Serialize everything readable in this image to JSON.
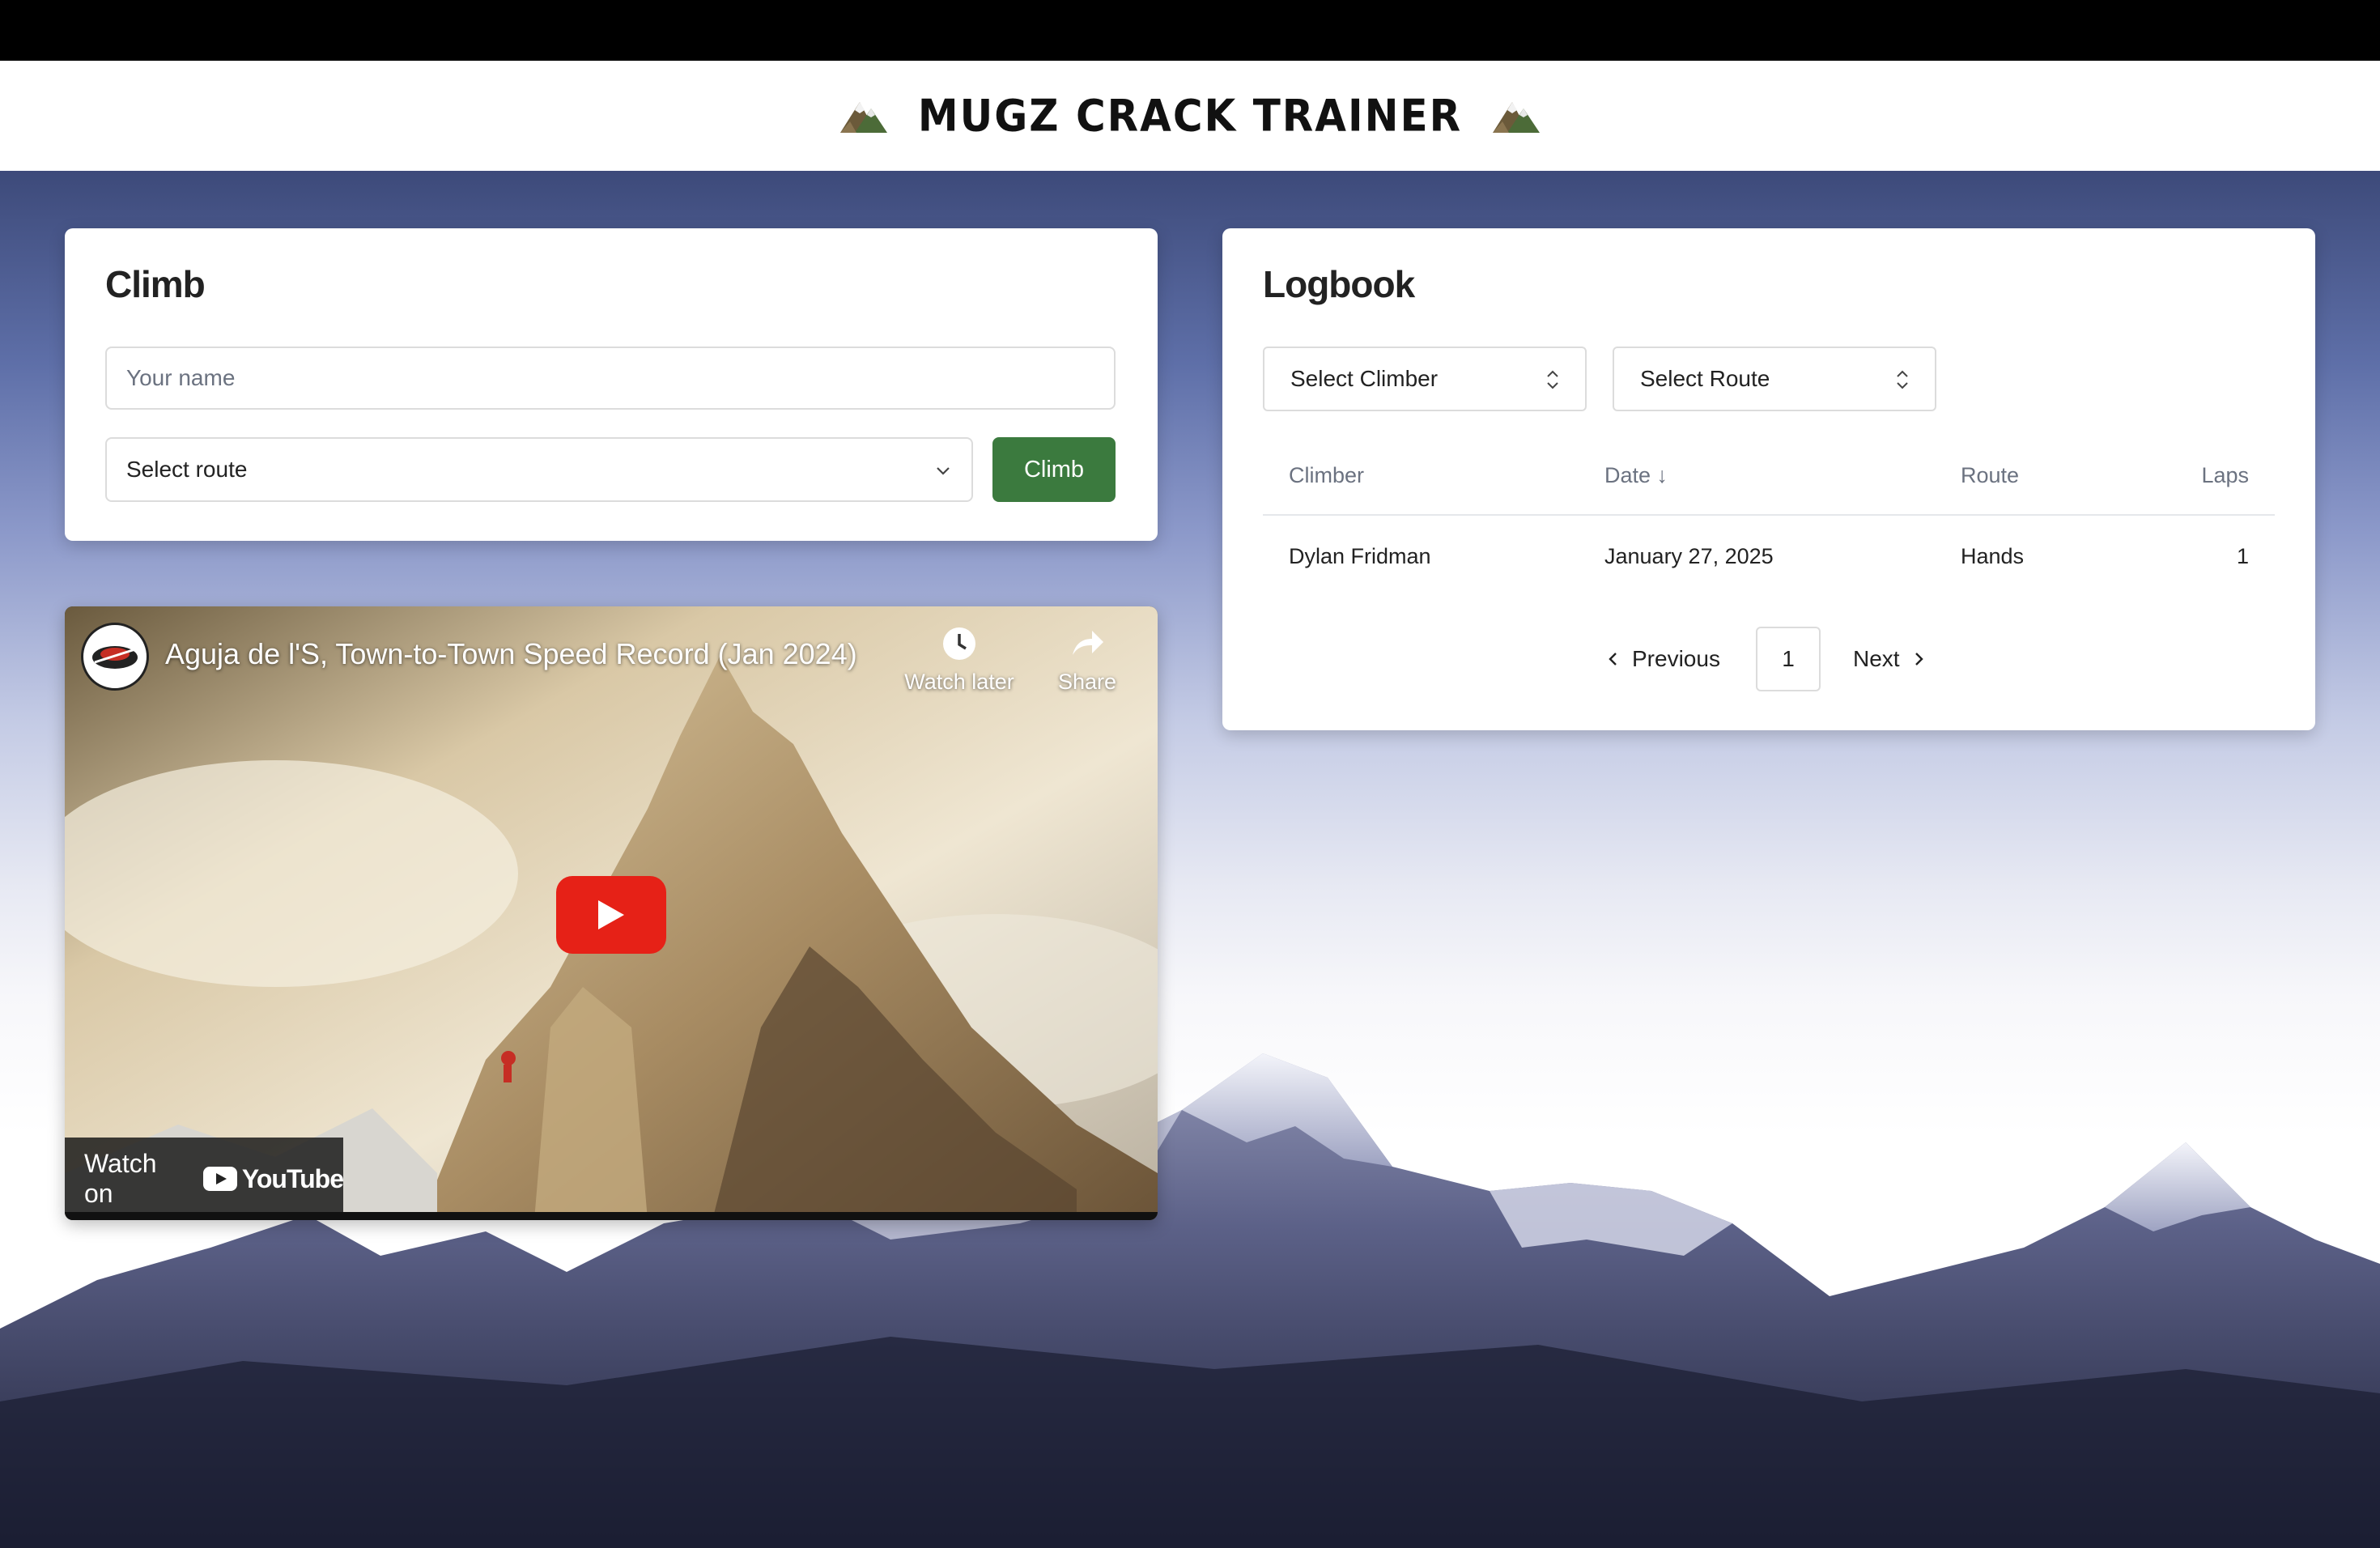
{
  "header": {
    "title": "MUGZ CRACK TRAINER",
    "left_icon": "mountain-icon",
    "right_icon": "mountain-icon"
  },
  "climb": {
    "title": "Climb",
    "name_placeholder": "Your name",
    "route_select": "Select route",
    "climb_button": "Climb"
  },
  "video": {
    "title": "Aguja de l'S, Town-to-Town Speed Record (Jan 2024)",
    "watch_later": "Watch later",
    "share": "Share",
    "watch_on": "Watch on",
    "youtube": "YouTube"
  },
  "logbook": {
    "title": "Logbook",
    "filter_climber": "Select Climber",
    "filter_route": "Select Route",
    "columns": {
      "climber": "Climber",
      "date": "Date ↓",
      "route": "Route",
      "laps": "Laps"
    },
    "rows": [
      {
        "climber": "Dylan Fridman",
        "date": "January 27, 2025",
        "route": "Hands",
        "laps": "1"
      }
    ],
    "pagination": {
      "previous": "Previous",
      "page": "1",
      "next": "Next"
    }
  },
  "colors": {
    "climb_button": "#3b7a3e",
    "play_button": "#e62117"
  }
}
